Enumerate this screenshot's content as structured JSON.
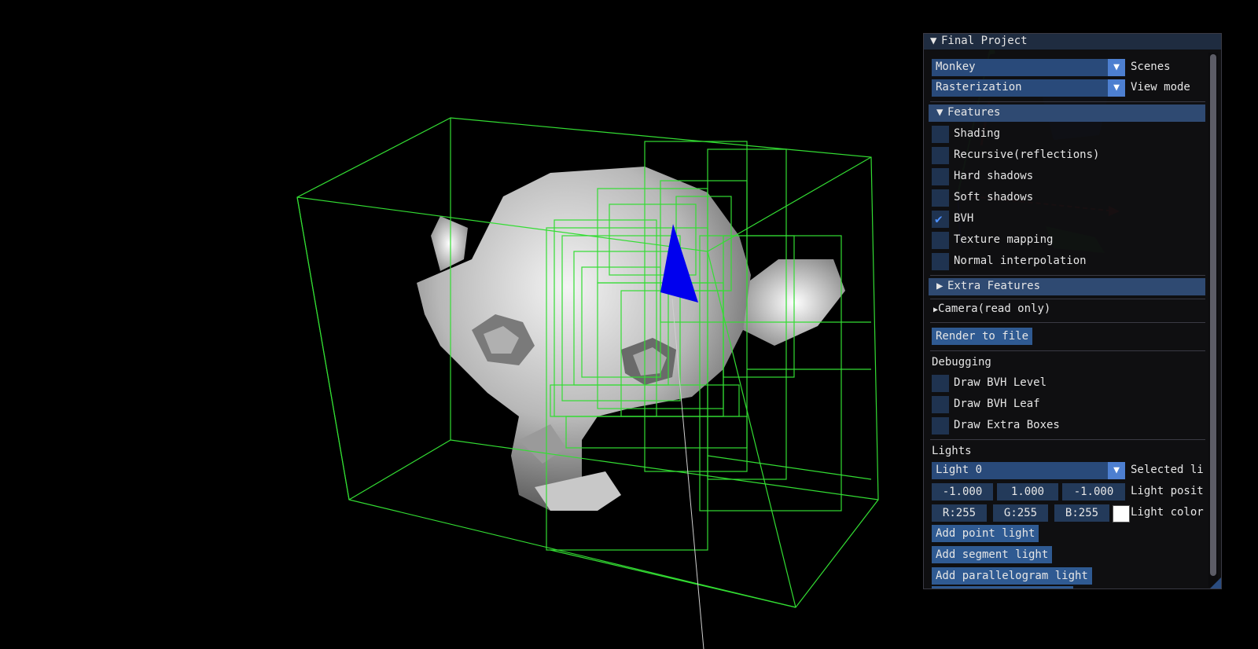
{
  "panel": {
    "title": "Final Project",
    "scene_value": "Monkey",
    "scene_label": "Scenes",
    "viewmode_value": "Rasterization",
    "viewmode_label": "View mode",
    "features_header": "Features",
    "features": [
      {
        "label": "Shading",
        "checked": false
      },
      {
        "label": "Recursive(reflections)",
        "checked": false
      },
      {
        "label": "Hard shadows",
        "checked": false
      },
      {
        "label": "Soft shadows",
        "checked": false
      },
      {
        "label": "BVH",
        "checked": true
      },
      {
        "label": "Texture mapping",
        "checked": false
      },
      {
        "label": "Normal interpolation",
        "checked": false
      }
    ],
    "extra_features_header": "Extra Features",
    "camera_node": "Camera(read only)",
    "render_button": "Render to file",
    "debugging_label": "Debugging",
    "debug": [
      {
        "label": "Draw BVH Level",
        "checked": false
      },
      {
        "label": "Draw BVH Leaf",
        "checked": false
      },
      {
        "label": "Draw Extra Boxes",
        "checked": false
      }
    ],
    "lights_label": "Lights",
    "light_value": "Light 0",
    "light_selected_label": "Selected li",
    "position": [
      "-1.000",
      "1.000",
      "-1.000"
    ],
    "position_label": "Light posit",
    "color": [
      "R:255",
      "G:255",
      "B:255"
    ],
    "color_label": "Light color",
    "swatch_color": "#ffffff",
    "add_point": "Add point light",
    "add_segment": "Add segment light",
    "add_parallelogram": "Add parallelogram light"
  },
  "colors": {
    "bvh_boxes": "#33dd33",
    "triangle": "#0000ee",
    "gizmo_x": "#cc1111",
    "gizmo_y": "#22aa22",
    "gizmo_z": "#1111aa"
  }
}
